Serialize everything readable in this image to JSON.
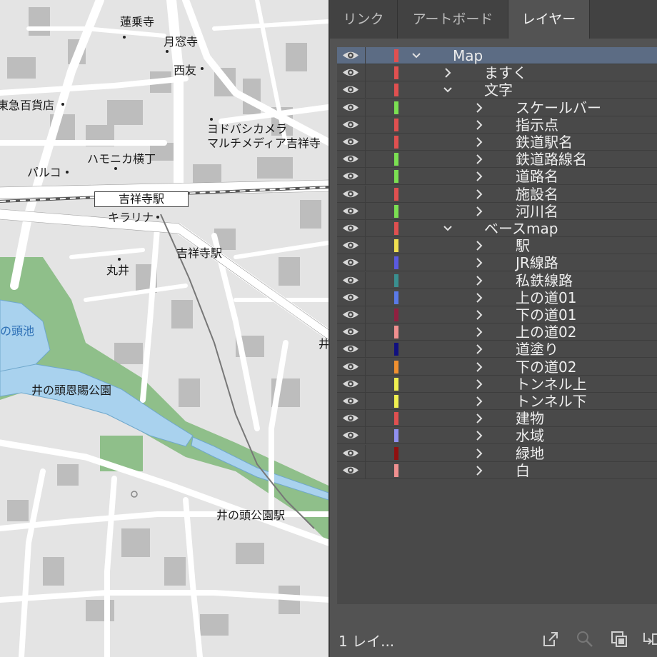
{
  "map": {
    "labels": {
      "renge": "蓮乗寺",
      "getsuso": "月窓寺",
      "seiyu": "西友",
      "tokyu": "東急百貨店",
      "yodobashi_1": "ヨドバシカメラ",
      "yodobashi_2": "マルチメディア吉祥寺",
      "harmonica": "ハモニカ横丁",
      "parco": "パルコ",
      "kichijoji_station": "吉祥寺駅",
      "kirarina": "キラリナ",
      "kichijoji_station_inokashira": "吉祥寺駅",
      "marui": "丸井",
      "pond": "の頭池",
      "park": "井の頭恩賜公園",
      "inokashira_koen_station": "井の頭公園駅",
      "edge_char": "井"
    }
  },
  "tabs": [
    {
      "label": "リンク",
      "active": false
    },
    {
      "label": "アートボード",
      "active": false
    },
    {
      "label": "レイヤー",
      "active": true
    }
  ],
  "layers": [
    {
      "name": "Map",
      "level": 0,
      "expanded": true,
      "color": "#e05050",
      "selected": true
    },
    {
      "name": "ますく",
      "level": 1,
      "expanded": false,
      "color": "#e05050"
    },
    {
      "name": "文字",
      "level": 1,
      "expanded": true,
      "color": "#e05050"
    },
    {
      "name": "スケールバー",
      "level": 2,
      "expanded": false,
      "color": "#7be052"
    },
    {
      "name": "指示点",
      "level": 2,
      "expanded": false,
      "color": "#e05050"
    },
    {
      "name": "鉄道駅名",
      "level": 2,
      "expanded": false,
      "color": "#e05050"
    },
    {
      "name": "鉄道路線名",
      "level": 2,
      "expanded": false,
      "color": "#7be052"
    },
    {
      "name": "道路名",
      "level": 2,
      "expanded": false,
      "color": "#7be052"
    },
    {
      "name": "施設名",
      "level": 2,
      "expanded": false,
      "color": "#e05050"
    },
    {
      "name": "河川名",
      "level": 2,
      "expanded": false,
      "color": "#7be052"
    },
    {
      "name": "ベースmap",
      "level": 1,
      "expanded": true,
      "color": "#e05050"
    },
    {
      "name": "駅",
      "level": 2,
      "expanded": false,
      "color": "#f0e050"
    },
    {
      "name": "JR線路",
      "level": 2,
      "expanded": false,
      "color": "#5a5ae0"
    },
    {
      "name": "私鉄線路",
      "level": 2,
      "expanded": false,
      "color": "#3a9090"
    },
    {
      "name": "上の道01",
      "level": 2,
      "expanded": false,
      "color": "#5a7ae8"
    },
    {
      "name": "下の道01",
      "level": 2,
      "expanded": false,
      "color": "#902040"
    },
    {
      "name": "上の道02",
      "level": 2,
      "expanded": false,
      "color": "#f09090"
    },
    {
      "name": "道塗り",
      "level": 2,
      "expanded": false,
      "color": "#101080"
    },
    {
      "name": "下の道02",
      "level": 2,
      "expanded": false,
      "color": "#f09030"
    },
    {
      "name": "トンネル上",
      "level": 2,
      "expanded": false,
      "color": "#f0f050"
    },
    {
      "name": "トンネル下",
      "level": 2,
      "expanded": false,
      "color": "#f0f050"
    },
    {
      "name": "建物",
      "level": 2,
      "expanded": false,
      "color": "#e05050"
    },
    {
      "name": "水域",
      "level": 2,
      "expanded": false,
      "color": "#9090f0"
    },
    {
      "name": "緑地",
      "level": 2,
      "expanded": false,
      "color": "#901010"
    },
    {
      "name": "白",
      "level": 2,
      "expanded": false,
      "color": "#f09090"
    }
  ],
  "footer": {
    "layer_count": "1 レイ...",
    "icons": [
      "export-icon",
      "search-icon",
      "new-sublayer-icon",
      "move-to-layer-icon"
    ]
  }
}
